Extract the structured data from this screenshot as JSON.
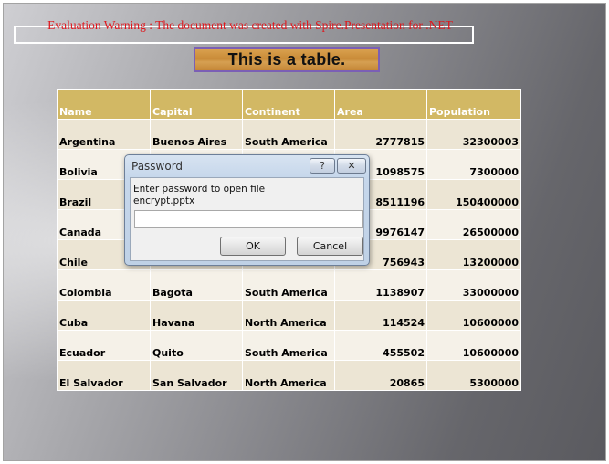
{
  "watermark": {
    "text": "Evaluation Warning : The document was created with  Spire.Presentation for .NET"
  },
  "slide": {
    "title": "This is a table."
  },
  "table": {
    "headers": [
      "Name",
      "Capital",
      "Continent",
      "Area",
      "Population"
    ],
    "rows": [
      [
        "Argentina",
        "Buenos Aires",
        "South America",
        "2777815",
        "32300003"
      ],
      [
        "Bolivia",
        "",
        "",
        "1098575",
        "7300000"
      ],
      [
        "Brazil",
        "",
        "",
        "8511196",
        "150400000"
      ],
      [
        "Canada",
        "",
        "",
        "9976147",
        "26500000"
      ],
      [
        "Chile",
        "",
        "",
        "756943",
        "13200000"
      ],
      [
        "Colombia",
        "Bagota",
        "South America",
        "1138907",
        "33000000"
      ],
      [
        "Cuba",
        "Havana",
        "North America",
        "114524",
        "10600000"
      ],
      [
        "Ecuador",
        "Quito",
        "South America",
        "455502",
        "10600000"
      ],
      [
        "El Salvador",
        "San Salvador",
        "North America",
        "20865",
        "5300000"
      ]
    ]
  },
  "dialog": {
    "title": "Password",
    "help_label": "?",
    "close_label": "✕",
    "prompt": "Enter password to open file\nencrypt.pptx",
    "password_value": "",
    "ok_label": "OK",
    "cancel_label": "Cancel"
  }
}
